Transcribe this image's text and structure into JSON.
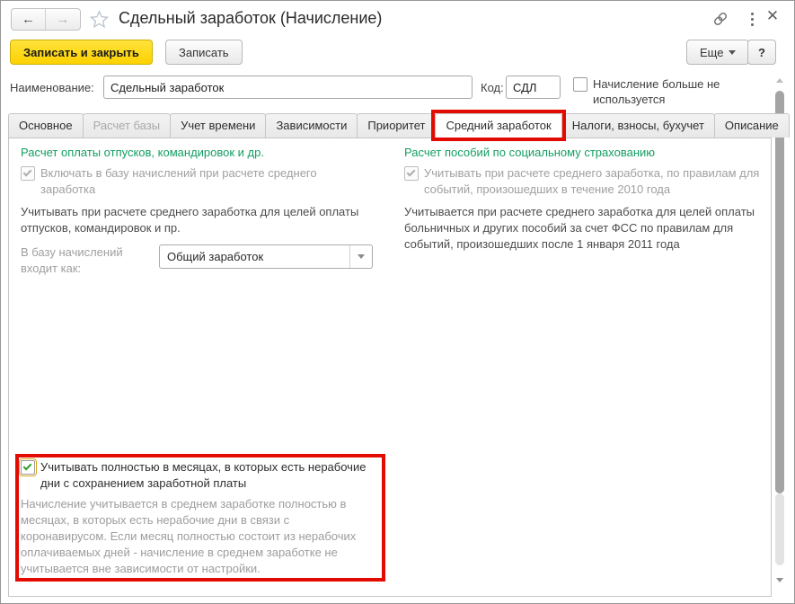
{
  "titlebar": {
    "title": "Сдельный заработок (Начисление)"
  },
  "toolbar": {
    "save_close_label": "Записать и закрыть",
    "save_label": "Записать",
    "more_label": "Еще",
    "help_label": "?"
  },
  "form": {
    "name_label": "Наименование:",
    "name_value": "Сдельный заработок",
    "code_label": "Код:",
    "code_value": "СДЛ",
    "not_used_label": "Начисление больше не используется",
    "not_used_checked": false
  },
  "tabs": [
    {
      "label": "Основное",
      "state": "normal"
    },
    {
      "label": "Расчет базы",
      "state": "disabled"
    },
    {
      "label": "Учет времени",
      "state": "normal"
    },
    {
      "label": "Зависимости",
      "state": "normal"
    },
    {
      "label": "Приоритет",
      "state": "normal"
    },
    {
      "label": "Средний заработок",
      "state": "active-highlighted"
    },
    {
      "label": "Налоги, взносы, бухучет",
      "state": "normal"
    },
    {
      "label": "Описание",
      "state": "normal"
    }
  ],
  "vacation_group": {
    "header": "Расчет оплаты отпусков, командировок и др.",
    "include_checkbox_label": "Включать в базу начислений при расчете среднего заработка",
    "include_checkbox_checked": true,
    "include_checkbox_disabled": true,
    "hint": "Учитывать при расчете среднего заработка для целей оплаты отпусков, командировок и пр.",
    "base_label": "В базу начислений входит как:",
    "base_value": "Общий заработок"
  },
  "social_group": {
    "header": "Расчет пособий по социальному страхованию",
    "rules2010_checkbox_label": "Учитывать при расчете среднего заработка, по правилам для событий, произошедших в течение 2010 года",
    "rules2010_checkbox_checked": true,
    "rules2010_checkbox_disabled": true,
    "hint": "Учитывается при расчете среднего заработка для целей оплаты больничных и других пособий за счет ФСС по правилам для событий, произошедших после 1 января 2011 года"
  },
  "covid_section": {
    "checkbox_label": "Учитывать полностью в месяцах, в которых есть нерабочие дни с сохранением заработной платы",
    "checkbox_checked": true,
    "hint": "Начисление учитывается в среднем заработке полностью в месяцах, в которых есть нерабочие дни в связи с коронавирусом. Если месяц полностью состоит из нерабочих оплачиваемых дней - начисление в среднем заработке не учитывается вне зависимости от настройки."
  },
  "colors": {
    "group_header_green": "#139e62",
    "annotation_red": "#e30b00",
    "primary_button_yellow": "#fdd200",
    "focus_outline_orange": "#d9a51d"
  }
}
